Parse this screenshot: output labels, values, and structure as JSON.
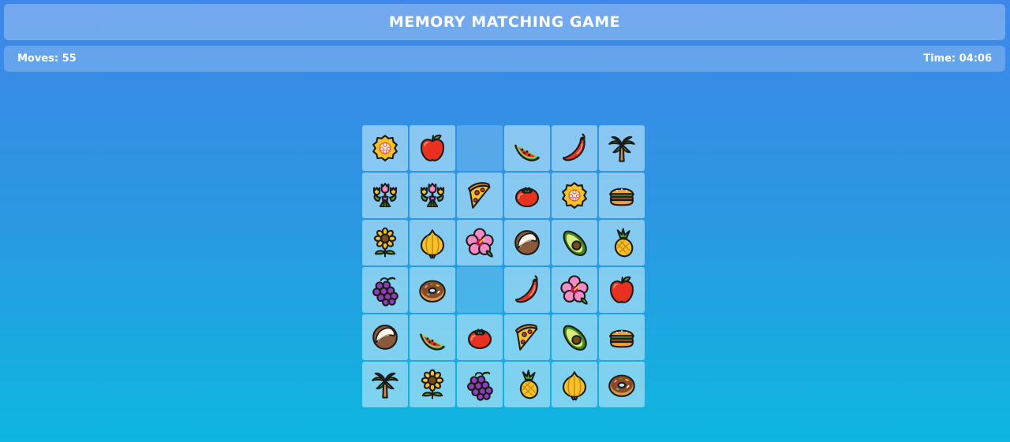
{
  "header": {
    "title": "MEMORY MATCHING GAME"
  },
  "status": {
    "moves": "Moves: 55",
    "time": "Time: 04:06"
  },
  "colors": {
    "background_top": "#3f86e9",
    "background_bottom": "#0db7df",
    "tile": "#bde8fa",
    "text": "#ffffff"
  },
  "board": {
    "rows": 6,
    "cols": 6,
    "tiles": [
      {
        "icon": "bouquet"
      },
      {
        "icon": "apple"
      },
      {
        "icon": "empty"
      },
      {
        "icon": "watermelon"
      },
      {
        "icon": "chili"
      },
      {
        "icon": "palm"
      },
      {
        "icon": "tulips"
      },
      {
        "icon": "tulips"
      },
      {
        "icon": "pizza"
      },
      {
        "icon": "tomato"
      },
      {
        "icon": "bouquet"
      },
      {
        "icon": "burger"
      },
      {
        "icon": "sunflower"
      },
      {
        "icon": "onion"
      },
      {
        "icon": "hibiscus"
      },
      {
        "icon": "coconut"
      },
      {
        "icon": "avocado"
      },
      {
        "icon": "pineapple"
      },
      {
        "icon": "grapes"
      },
      {
        "icon": "donut"
      },
      {
        "icon": "empty"
      },
      {
        "icon": "chili"
      },
      {
        "icon": "hibiscus"
      },
      {
        "icon": "apple"
      },
      {
        "icon": "coconut"
      },
      {
        "icon": "watermelon"
      },
      {
        "icon": "tomato"
      },
      {
        "icon": "pizza"
      },
      {
        "icon": "avocado"
      },
      {
        "icon": "burger"
      },
      {
        "icon": "palm"
      },
      {
        "icon": "sunflower"
      },
      {
        "icon": "grapes"
      },
      {
        "icon": "pineapple"
      },
      {
        "icon": "onion"
      },
      {
        "icon": "donut"
      }
    ]
  }
}
